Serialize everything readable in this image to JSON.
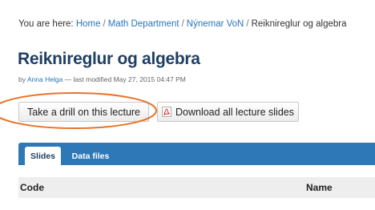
{
  "breadcrumb": {
    "prefix": "You are here: ",
    "items": [
      "Home",
      "Math Department",
      "Nýnemar VoN"
    ],
    "current": "Reiknireglur og algebra",
    "separator": "/"
  },
  "page": {
    "title": "Reiknireglur og algebra",
    "byline_prefix": "by ",
    "author": "Anna Helga",
    "modified": " — last modified May 27, 2015 04:47 PM"
  },
  "actions": {
    "drill_label": "Take a drill on this lecture",
    "download_label": "Download all lecture slides",
    "download_icon": "pdf-icon",
    "highlight_color": "#e8742b"
  },
  "tabs": [
    {
      "label": "Slides",
      "active": true
    },
    {
      "label": "Data files",
      "active": false
    }
  ],
  "table": {
    "columns": [
      "Code",
      "Name"
    ]
  },
  "colors": {
    "accent": "#2f78b7",
    "title": "#1f3f63",
    "link": "#2a75b8"
  }
}
